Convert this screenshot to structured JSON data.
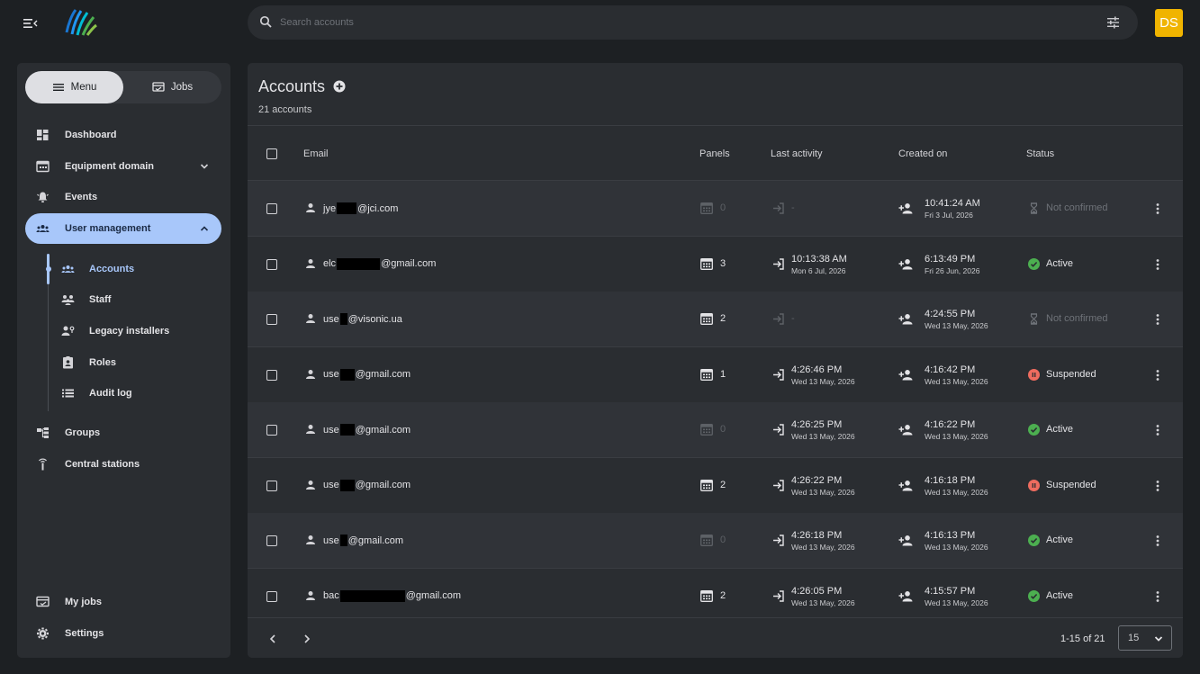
{
  "search": {
    "placeholder": "Search accounts"
  },
  "user": {
    "initials": "DS"
  },
  "colors": {
    "accent": "#a8c7fa",
    "active": "#4caf50",
    "suspended": "#ef6c5f",
    "avatar": "#f0b400"
  },
  "sidebar": {
    "segments": [
      {
        "label": "Menu",
        "icon": "menu-icon",
        "active": true
      },
      {
        "label": "Jobs",
        "icon": "jobs-icon",
        "active": false
      }
    ],
    "items": [
      {
        "label": "Dashboard",
        "icon": "dashboard-icon"
      },
      {
        "label": "Equipment domain",
        "icon": "equipment-icon"
      },
      {
        "label": "Events",
        "icon": "bell-icon"
      },
      {
        "label": "User management",
        "icon": "people-icon"
      },
      {
        "label": "Groups",
        "icon": "groups-icon"
      },
      {
        "label": "Central stations",
        "icon": "antenna-icon"
      },
      {
        "label": "My jobs",
        "icon": "jobs-icon"
      },
      {
        "label": "Settings",
        "icon": "gear-icon"
      }
    ],
    "sub_items": [
      {
        "label": "Accounts",
        "icon": "people-icon"
      },
      {
        "label": "Staff",
        "icon": "staff-icon"
      },
      {
        "label": "Legacy installers",
        "icon": "installer-icon"
      },
      {
        "label": "Roles",
        "icon": "badge-icon"
      },
      {
        "label": "Audit log",
        "icon": "list-icon"
      }
    ]
  },
  "main": {
    "title": "Accounts",
    "count": "21 accounts",
    "columns": {
      "email": "Email",
      "panels": "Panels",
      "last_activity": "Last activity",
      "created_on": "Created on",
      "status": "Status"
    },
    "rows": [
      {
        "email_prefix": "jye",
        "email_suffix": "@jci.com",
        "panels": "0",
        "last_time": "",
        "last_date": "",
        "last_dash": "-",
        "created_time": "10:41:24 AM",
        "created_date": "Fri 3 Jul, 2026",
        "status": "Not confirmed"
      },
      {
        "email_prefix": "elc",
        "email_suffix": "@gmail.com",
        "panels": "3",
        "last_time": "10:13:38 AM",
        "last_date": "Mon 6 Jul, 2026",
        "last_dash": "",
        "created_time": "6:13:49 PM",
        "created_date": "Fri 26 Jun, 2026",
        "status": "Active"
      },
      {
        "email_prefix": "use",
        "email_suffix": "@visonic.ua",
        "panels": "2",
        "last_time": "",
        "last_date": "",
        "last_dash": "-",
        "created_time": "4:24:55 PM",
        "created_date": "Wed 13 May, 2026",
        "status": "Not confirmed"
      },
      {
        "email_prefix": "use",
        "email_suffix": "@gmail.com",
        "panels": "1",
        "last_time": "4:26:46 PM",
        "last_date": "Wed 13 May, 2026",
        "last_dash": "",
        "created_time": "4:16:42 PM",
        "created_date": "Wed 13 May, 2026",
        "status": "Suspended"
      },
      {
        "email_prefix": "use",
        "email_suffix": "@gmail.com",
        "panels": "0",
        "last_time": "4:26:25 PM",
        "last_date": "Wed 13 May, 2026",
        "last_dash": "",
        "created_time": "4:16:22 PM",
        "created_date": "Wed 13 May, 2026",
        "status": "Active"
      },
      {
        "email_prefix": "use",
        "email_suffix": "@gmail.com",
        "panels": "2",
        "last_time": "4:26:22 PM",
        "last_date": "Wed 13 May, 2026",
        "last_dash": "",
        "created_time": "4:16:18 PM",
        "created_date": "Wed 13 May, 2026",
        "status": "Suspended"
      },
      {
        "email_prefix": "use",
        "email_suffix": "@gmail.com",
        "panels": "0",
        "last_time": "4:26:18 PM",
        "last_date": "Wed 13 May, 2026",
        "last_dash": "",
        "created_time": "4:16:13 PM",
        "created_date": "Wed 13 May, 2026",
        "status": "Active"
      },
      {
        "email_prefix": "bac",
        "email_suffix": "@gmail.com",
        "panels": "2",
        "last_time": "4:26:05 PM",
        "last_date": "Wed 13 May, 2026",
        "last_dash": "",
        "created_time": "4:15:57 PM",
        "created_date": "Wed 13 May, 2026",
        "status": "Active"
      }
    ]
  },
  "pagination": {
    "range": "1-15 of 21",
    "per_page": "15"
  }
}
